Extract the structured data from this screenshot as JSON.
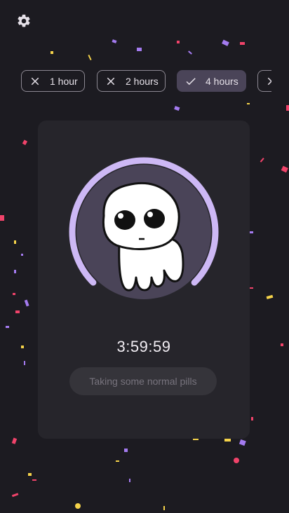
{
  "header": {
    "settings_icon": "gear-icon"
  },
  "chips": [
    {
      "label": "1 hour",
      "selected": false,
      "icon": "close-icon"
    },
    {
      "label": "2 hours",
      "selected": false,
      "icon": "close-icon"
    },
    {
      "label": "4 hours",
      "selected": true,
      "icon": "check-icon"
    }
  ],
  "timer": {
    "value": "3:59:59",
    "progress": 0.75
  },
  "status_button": {
    "label": "Taking some normal pills",
    "enabled": false
  },
  "colors": {
    "background": "#1c1b21",
    "card": "#26252b",
    "accent": "#cdb8f5",
    "selected_chip": "#4a4458",
    "confetti_pink": "#f0436a",
    "confetti_purple": "#a47bf0",
    "confetti_yellow": "#f5d34a"
  }
}
